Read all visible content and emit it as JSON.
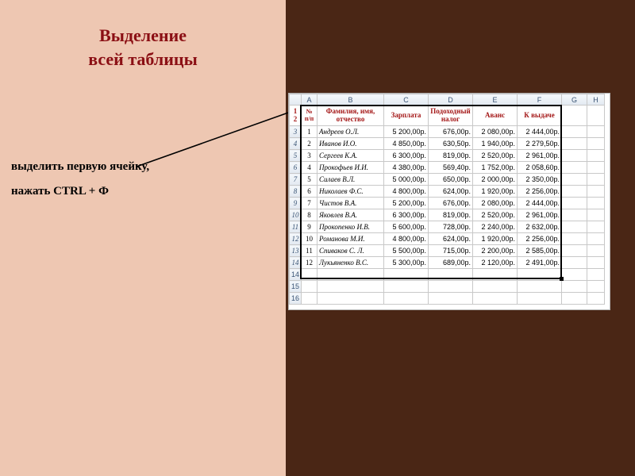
{
  "title_line1": "Выделение",
  "title_line2": "всей таблицы",
  "instruction1": "выделить первую ячейку,",
  "instruction2": "нажать CTRL + Ф",
  "columns": [
    "A",
    "B",
    "C",
    "D",
    "E",
    "F",
    "G",
    "H"
  ],
  "headers": {
    "a": "№ п/п",
    "b": "Фамилия, имя, отчество",
    "c": "Зарплата",
    "d": "Подоходный налог",
    "e": "Аванс",
    "f": "К выдаче"
  },
  "rows": [
    {
      "n": "1",
      "name": "Андреев О.Л.",
      "c": "5 200,00р.",
      "d": "676,00р.",
      "e": "2 080,00р.",
      "f": "2 444,00р."
    },
    {
      "n": "2",
      "name": "Иванов И.О.",
      "c": "4 850,00р.",
      "d": "630,50р.",
      "e": "1 940,00р.",
      "f": "2 279,50р."
    },
    {
      "n": "3",
      "name": "Сергеев К.А.",
      "c": "6 300,00р.",
      "d": "819,00р.",
      "e": "2 520,00р.",
      "f": "2 961,00р."
    },
    {
      "n": "4",
      "name": "Прокофьев И.И.",
      "c": "4 380,00р.",
      "d": "569,40р.",
      "e": "1 752,00р.",
      "f": "2 058,60р."
    },
    {
      "n": "5",
      "name": "Силаев В.Л.",
      "c": "5 000,00р.",
      "d": "650,00р.",
      "e": "2 000,00р.",
      "f": "2 350,00р."
    },
    {
      "n": "6",
      "name": "Николаев Ф.С.",
      "c": "4 800,00р.",
      "d": "624,00р.",
      "e": "1 920,00р.",
      "f": "2 256,00р."
    },
    {
      "n": "7",
      "name": "Чистов В.А.",
      "c": "5 200,00р.",
      "d": "676,00р.",
      "e": "2 080,00р.",
      "f": "2 444,00р."
    },
    {
      "n": "8",
      "name": "Яковлев В.А.",
      "c": "6 300,00р.",
      "d": "819,00р.",
      "e": "2 520,00р.",
      "f": "2 961,00р."
    },
    {
      "n": "9",
      "name": "Прокопенко И.В.",
      "c": "5 600,00р.",
      "d": "728,00р.",
      "e": "2 240,00р.",
      "f": "2 632,00р."
    },
    {
      "n": "10",
      "name": "Романова М.И.",
      "c": "4 800,00р.",
      "d": "624,00р.",
      "e": "1 920,00р.",
      "f": "2 256,00р."
    },
    {
      "n": "11",
      "name": "Спиваков С. Л.",
      "c": "5 500,00р.",
      "d": "715,00р.",
      "e": "2 200,00р.",
      "f": "2 585,00р."
    },
    {
      "n": "12",
      "name": "Лукьяненко В.С.",
      "c": "5 300,00р.",
      "d": "689,00р.",
      "e": "2 120,00р.",
      "f": "2 491,00р."
    }
  ],
  "empty_rows": [
    "14",
    "15",
    "16"
  ]
}
